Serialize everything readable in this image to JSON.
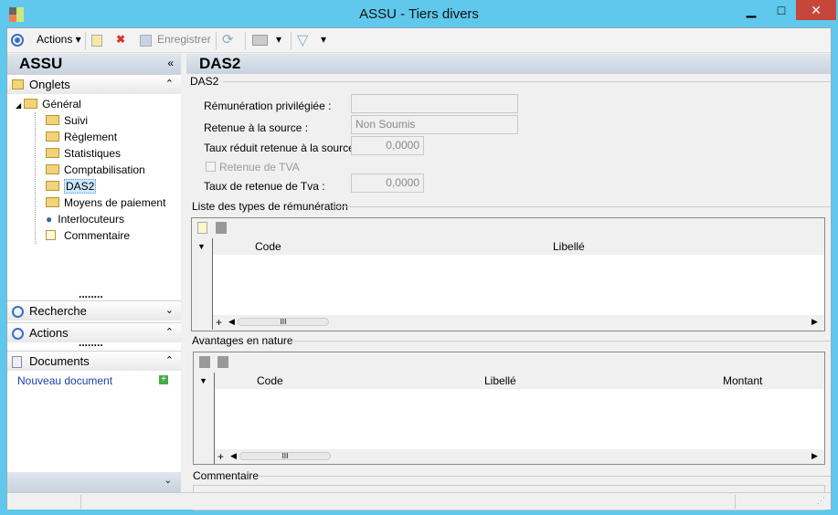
{
  "window": {
    "title": "ASSU -  Tiers divers",
    "min": "▁",
    "max": "□",
    "close": "✕"
  },
  "toolbar": {
    "actions": "Actions ▾",
    "save": "Enregistrer",
    "dropdown": "▾"
  },
  "left": {
    "title": "ASSU",
    "collapse": "«",
    "onglets": "Onglets",
    "up": "⌃",
    "tree": {
      "root": "Général",
      "items": [
        "Suivi",
        "Règlement",
        "Statistiques",
        "Comptabilisation",
        "DAS2",
        "Moyens de paiement",
        "Interlocuteurs",
        "Commentaire"
      ]
    },
    "recherche": "Recherche",
    "actions": "Actions",
    "documents": "Documents",
    "new_doc": "Nouveau document",
    "down": "⌄",
    "grip": "........"
  },
  "main": {
    "title": "DAS2",
    "group": "DAS2",
    "fields": [
      {
        "label": "Rémunération privilégiée :",
        "value": ""
      },
      {
        "label": "Retenue à la source :",
        "value": "Non Soumis"
      },
      {
        "label": "Taux réduit retenue à la source :",
        "value": "0,0000"
      },
      {
        "label": "Retenue de TVA",
        "value": ""
      },
      {
        "label": "Taux de retenue de Tva :",
        "value": "0,0000"
      }
    ],
    "list1": {
      "title": "Liste des types de rémunération",
      "cols": [
        "Code",
        "Libellé"
      ]
    },
    "list2": {
      "title": "Avantages en nature",
      "cols": [
        "Code",
        "Libellé",
        "Montant"
      ]
    },
    "comment": "Commentaire",
    "plus": "+",
    "scroll": "III"
  }
}
